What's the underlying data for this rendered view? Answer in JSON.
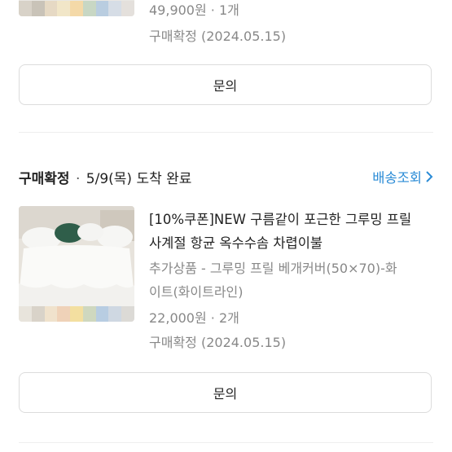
{
  "order1": {
    "price_qty": "49,900원 · 1개",
    "confirm": "구매확정 (2024.05.15)",
    "inquiry_label": "문의",
    "swatch_colors": [
      "#d8d2c8",
      "#c9c3b8",
      "#e6d9c4",
      "#f1e6c8",
      "#f4d9a8",
      "#c8d7c4",
      "#b9cde0",
      "#d6dde6",
      "#e4e0dc"
    ]
  },
  "order2": {
    "status": "구매확정",
    "delivery": "5/9(목) 도착 완료",
    "tracking_label": "배송조회",
    "title_line1": "[10%쿠폰]NEW 구름같이 포근한 그루밍 프릴",
    "title_line2": "사계절 항균 옥수수솜 차렵이불",
    "option_line1": "추가상품 - 그루밍 프릴 베개커버(50×70)-화",
    "option_line2": "이트(화이트라인)",
    "price_qty": "22,000원 · 2개",
    "confirm": "구매확정 (2024.05.15)",
    "inquiry_label": "문의",
    "swatch_colors": [
      "#e8e4dc",
      "#d9d3c9",
      "#f0e2cc",
      "#efd2b8",
      "#f3dfa0",
      "#cfd8bf",
      "#b8cde2",
      "#cfd8e2",
      "#dcdad6"
    ]
  }
}
